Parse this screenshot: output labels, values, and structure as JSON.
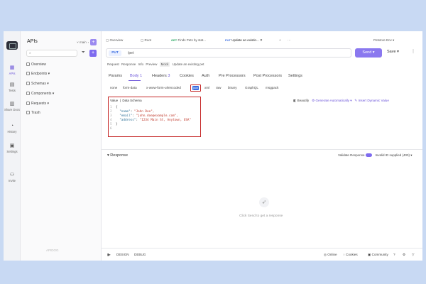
{
  "iconbar": {
    "items": [
      {
        "label": "APIs"
      },
      {
        "label": "Tests"
      },
      {
        "label": "Share Docs"
      },
      {
        "label": "History"
      },
      {
        "label": "Settings"
      },
      {
        "label": "Invite"
      }
    ]
  },
  "sidebar": {
    "title": "APIs",
    "branch": "main",
    "search_placeholder": "",
    "plus": "+",
    "nav": [
      {
        "label": "Overview"
      },
      {
        "label": "Endpoints"
      },
      {
        "label": "Schemas"
      },
      {
        "label": "Components"
      },
      {
        "label": "Requests"
      },
      {
        "label": "Trash"
      }
    ]
  },
  "tabs": [
    {
      "label": "Overview"
    },
    {
      "label": "Root"
    },
    {
      "method": "GET",
      "label": "Finds Pets by stat..."
    },
    {
      "method": "PUT",
      "label": "Update an existin..."
    }
  ],
  "env": "Petstore Env",
  "request": {
    "method": "PUT",
    "url": "/pet",
    "send": "Send",
    "save": "Save"
  },
  "subtabs": [
    "Request",
    "Response",
    "Info",
    "Preview",
    "Mock",
    "Update an existing pet"
  ],
  "maintabs": [
    {
      "label": "Params",
      "count": ""
    },
    {
      "label": "Body",
      "count": "1"
    },
    {
      "label": "Headers",
      "count": "3"
    },
    {
      "label": "Cookies",
      "count": ""
    },
    {
      "label": "Auth",
      "count": ""
    },
    {
      "label": "Pre Processors",
      "count": ""
    },
    {
      "label": "Post Processors",
      "count": ""
    },
    {
      "label": "Settings",
      "count": ""
    }
  ],
  "bodytypes": [
    "none",
    "form-data",
    "x-www-form-urlencoded",
    "json",
    "xml",
    "raw",
    "binary",
    "GraphQL",
    "msgpack"
  ],
  "editor": {
    "tab_value": "Value",
    "tab_schema": "Data Schema",
    "beautify": "Beautify",
    "generate": "Generate Automatically",
    "insert": "Insert Dynamic Value",
    "lines": [
      {
        "n": "1",
        "text": "{"
      },
      {
        "n": "2",
        "key": "\"name\"",
        "val": "\"John Doe\","
      },
      {
        "n": "3",
        "key": "\"email\"",
        "val": "\"john.doe@example.com\","
      },
      {
        "n": "4",
        "key": "\"address\"",
        "val": "\"1234 Main St, Anytown, USA\""
      },
      {
        "n": "5",
        "text": "}"
      },
      {
        "n": "6",
        "text": ""
      }
    ]
  },
  "response": {
    "title": "Response",
    "validate": "Validate Response",
    "status": "Invalid ID supplied (400)",
    "hint": "Click Send to get a response"
  },
  "bottom": {
    "design": "DESIGN",
    "debug": "DEBUG",
    "online": "Online",
    "cookies": "Cookies",
    "community": "Community"
  },
  "footer_brand": "APIDOG"
}
